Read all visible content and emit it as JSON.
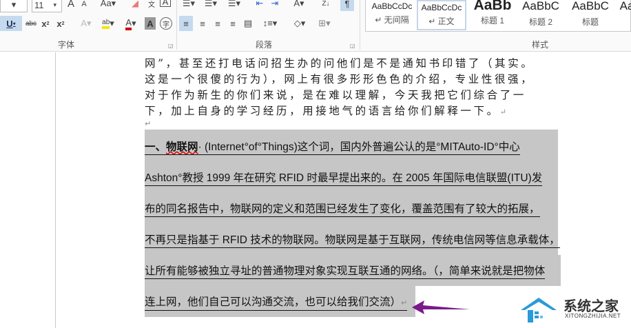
{
  "ribbon": {
    "font_size": "11",
    "groups": {
      "font": "字体",
      "paragraph": "段落",
      "styles": "样式"
    },
    "styles": [
      {
        "preview": "AaBbCcDc",
        "name": "↵ 无间隔"
      },
      {
        "preview": "AaBbCcDc",
        "name": "↵ 正文"
      },
      {
        "preview": "AaBb",
        "name": "标题 1"
      },
      {
        "preview": "AaBbC",
        "name": "标题 2"
      },
      {
        "preview": "AaBbC",
        "name": "标题"
      },
      {
        "preview": "Aa",
        "name": ""
      }
    ],
    "colors": {
      "highlight": "#f5e700",
      "font_color": "#d10000"
    }
  },
  "document": {
    "lines_before": [
      "网”，甚至还打电话问招生办的问他们是不是通知书印错了（其实。",
      "这是一个很傻的行为），网上有很多形形色色的介绍，专业性很强，",
      "对于作为新生的你们来说，是在难以理解，今天我把它们综合了一",
      "下，加上自身的学习经历，用接地气的语言给你们解释一下。"
    ],
    "heading_prefix": "一、",
    "heading_term": "物联网",
    "selected_lines": [
      "· (Internet°of°Things)这个词，国内外普遍公认的是°MITAuto-ID°中心",
      "Ashton°教授 1999 年在研究 RFID 时最早提出来的。在 2005 年国际电信联盟(ITU)发",
      "布的同名报告中，物联网的定义和范围已经发生了变化，覆盖范围有了较大的拓展，",
      "不再只是指基于 RFID 技术的物联网。物联网是基于互联网，传统电信网等信息承载体，",
      "让所有能够被独立寻址的普通物理对象实现互联互通的网络。（，简单来说就是把物体",
      "连上网，他们自己可以沟通交流，也可以给我们交流）"
    ],
    "paragraph_mark": "↵",
    "selection_color": "#c6c6c6",
    "arrow_color": "#7a1a8a"
  },
  "watermark": {
    "title": "系统之家",
    "url": "XITONGZHIJIA.NET"
  }
}
